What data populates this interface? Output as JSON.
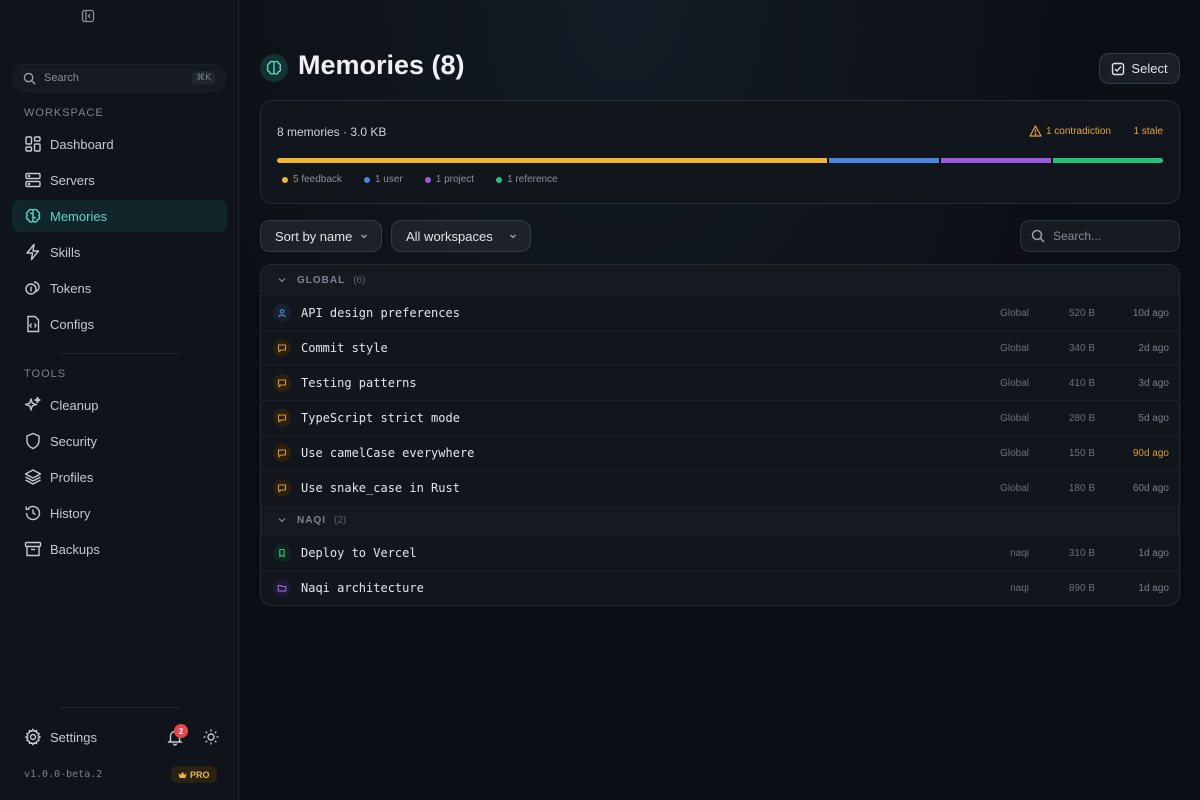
{
  "sidebar": {
    "search_placeholder": "Search",
    "search_shortcut": "⌘K",
    "workspace_label": "WORKSPACE",
    "workspace_items": [
      "Dashboard",
      "Servers",
      "Memories",
      "Skills",
      "Tokens",
      "Configs"
    ],
    "tools_label": "TOOLS",
    "tools_items": [
      "Cleanup",
      "Security",
      "Profiles",
      "History",
      "Backups"
    ],
    "active_item": "Memories",
    "settings_label": "Settings",
    "notification_count": "2",
    "version": "v1.0.0-beta.2",
    "plan_badge": "PRO"
  },
  "header": {
    "title": "Memories (8)",
    "select_label": "Select"
  },
  "summary": {
    "text": "8 memories · 3.0 KB",
    "contradiction": "1 contradiction",
    "stale": "1 stale",
    "legend": [
      {
        "label": "5 feedback",
        "count": 5,
        "color": "#f0b430"
      },
      {
        "label": "1 user",
        "count": 1,
        "color": "#4a86e0"
      },
      {
        "label": "1 project",
        "count": 1,
        "color": "#9b59e0"
      },
      {
        "label": "1 reference",
        "count": 1,
        "color": "#22c27a"
      }
    ]
  },
  "filters": {
    "sort_label": "Sort by name",
    "workspace_filter": "All workspaces",
    "search_placeholder": "Search..."
  },
  "groups": [
    {
      "name": "GLOBAL",
      "count": "(6)",
      "rows": [
        {
          "name": "API design preferences",
          "scope": "Global",
          "size": "520 B",
          "age": "10d ago",
          "kind": "user",
          "stale": false
        },
        {
          "name": "Commit style",
          "scope": "Global",
          "size": "340 B",
          "age": "2d ago",
          "kind": "feedback",
          "stale": false
        },
        {
          "name": "Testing patterns",
          "scope": "Global",
          "size": "410 B",
          "age": "3d ago",
          "kind": "feedback",
          "stale": false
        },
        {
          "name": "TypeScript strict mode",
          "scope": "Global",
          "size": "280 B",
          "age": "5d ago",
          "kind": "feedback",
          "stale": false
        },
        {
          "name": "Use camelCase everywhere",
          "scope": "Global",
          "size": "150 B",
          "age": "90d ago",
          "kind": "feedback",
          "stale": true
        },
        {
          "name": "Use snake_case in Rust",
          "scope": "Global",
          "size": "180 B",
          "age": "60d ago",
          "kind": "feedback",
          "stale": false
        }
      ]
    },
    {
      "name": "NAQI",
      "count": "(2)",
      "rows": [
        {
          "name": "Deploy to Vercel",
          "scope": "naqi",
          "size": "310 B",
          "age": "1d ago",
          "kind": "reference",
          "stale": false
        },
        {
          "name": "Naqi architecture",
          "scope": "naqi",
          "size": "890 B",
          "age": "1d ago",
          "kind": "project",
          "stale": false
        }
      ]
    }
  ]
}
